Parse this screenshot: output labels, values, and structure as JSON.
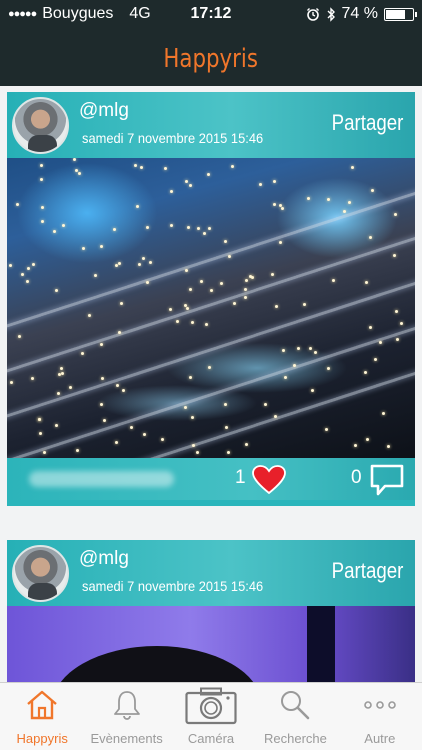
{
  "status_bar": {
    "signal": "●●●●●",
    "carrier": "Bouygues",
    "network": "4G",
    "time": "17:12",
    "battery_percent": "74 %",
    "battery_level": 0.74
  },
  "header": {
    "title": "Happyris",
    "accent_color": "#f0762b"
  },
  "posts": [
    {
      "username": "@mlg",
      "date": "samedi 7 novembre 2015 15:46",
      "share_label": "Partager",
      "likes": "1",
      "comments": "0"
    },
    {
      "username": "@mlg",
      "date": "samedi 7 novembre 2015 15:46",
      "share_label": "Partager"
    }
  ],
  "tabs": [
    {
      "label": "Happyris",
      "icon": "home-icon",
      "active": true
    },
    {
      "label": "Evènements",
      "icon": "bell-icon",
      "active": false
    },
    {
      "label": "Caméra",
      "icon": "camera-icon",
      "active": false
    },
    {
      "label": "Recherche",
      "icon": "search-icon",
      "active": false
    },
    {
      "label": "Autre",
      "icon": "more-icon",
      "active": false
    }
  ],
  "colors": {
    "bar_background": "#1e2a2c",
    "card_teal": "#2bb5bb",
    "heart_red": "#e8202a"
  }
}
